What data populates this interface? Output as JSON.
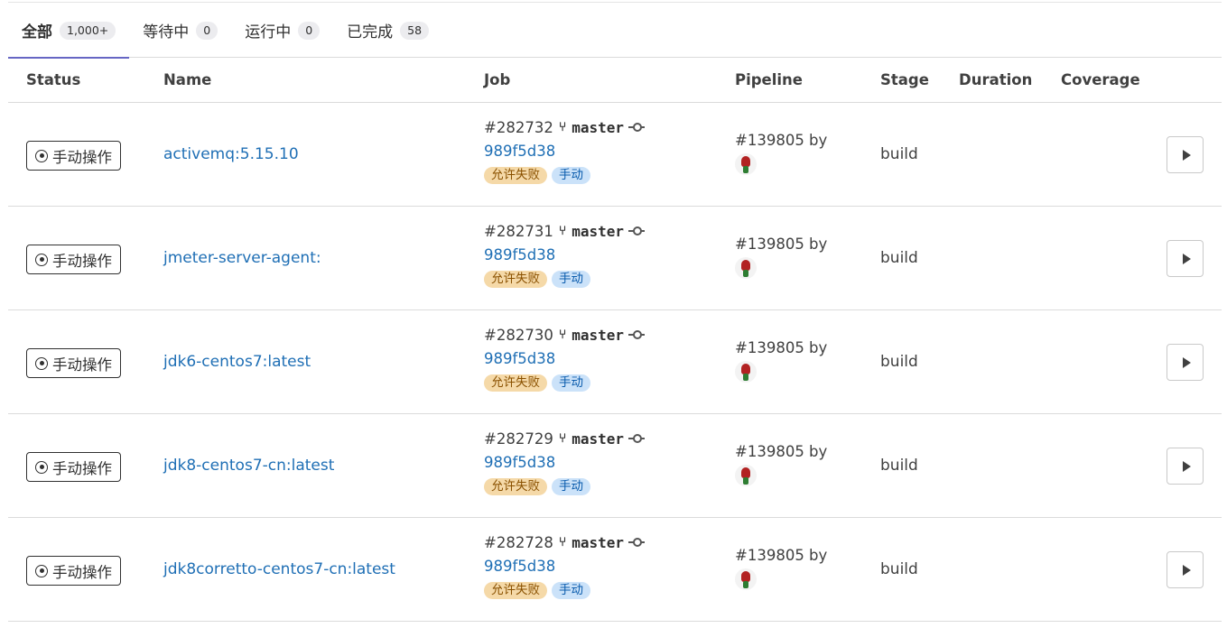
{
  "tabs": [
    {
      "label": "全部",
      "count": "1,000+"
    },
    {
      "label": "等待中",
      "count": "0"
    },
    {
      "label": "运行中",
      "count": "0"
    },
    {
      "label": "已完成",
      "count": "58"
    }
  ],
  "columns": {
    "status": "Status",
    "name": "Name",
    "job": "Job",
    "pipeline": "Pipeline",
    "stage": "Stage",
    "duration": "Duration",
    "coverage": "Coverage"
  },
  "rows": [
    {
      "status": "手动操作",
      "name": "activemq:5.15.10",
      "job_id": "#282732",
      "branch": "master",
      "sha": "989f5d38",
      "label_allow_fail": "允许失败",
      "label_manual": "手动",
      "pipeline": "#139805 by",
      "stage": "build"
    },
    {
      "status": "手动操作",
      "name": "jmeter-server-agent:",
      "job_id": "#282731",
      "branch": "master",
      "sha": "989f5d38",
      "label_allow_fail": "允许失败",
      "label_manual": "手动",
      "pipeline": "#139805 by",
      "stage": "build"
    },
    {
      "status": "手动操作",
      "name": "jdk6-centos7:latest",
      "job_id": "#282730",
      "branch": "master",
      "sha": "989f5d38",
      "label_allow_fail": "允许失败",
      "label_manual": "手动",
      "pipeline": "#139805 by",
      "stage": "build"
    },
    {
      "status": "手动操作",
      "name": "jdk8-centos7-cn:latest",
      "job_id": "#282729",
      "branch": "master",
      "sha": "989f5d38",
      "label_allow_fail": "允许失败",
      "label_manual": "手动",
      "pipeline": "#139805 by",
      "stage": "build"
    },
    {
      "status": "手动操作",
      "name": "jdk8corretto-centos7-cn:latest",
      "job_id": "#282728",
      "branch": "master",
      "sha": "989f5d38",
      "label_allow_fail": "允许失败",
      "label_manual": "手动",
      "pipeline": "#139805 by",
      "stage": "build"
    }
  ],
  "colors": {
    "link": "#1f6fb5",
    "tab_active_underline": "#6666c4",
    "label_allow_fail_bg": "#f5d9a8",
    "label_manual_bg": "#cbe2f9"
  },
  "icons": {
    "status": "gear-icon",
    "branch": "branch-fork-icon",
    "commit": "commit-icon",
    "play": "play-icon",
    "avatar": "user-avatar"
  }
}
